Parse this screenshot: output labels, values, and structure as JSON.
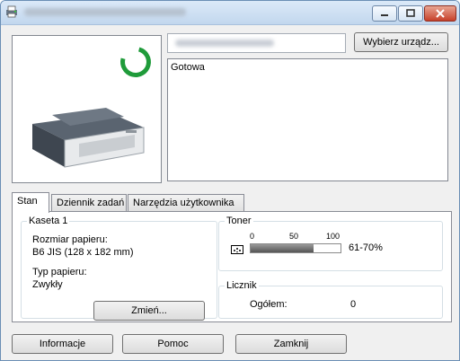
{
  "printer": {
    "status": "Gotowa"
  },
  "buttons": {
    "select_device": "Wybierz urządz...",
    "change": "Zmień...",
    "info": "Informacje",
    "help": "Pomoc",
    "close": "Zamknij"
  },
  "tabs": [
    {
      "label": "Stan",
      "active": true
    },
    {
      "label": "Dziennik zadań",
      "active": false
    },
    {
      "label": "Narzędzia użytkownika",
      "active": false
    }
  ],
  "tray": {
    "title": "Kaseta 1",
    "paper_size_label": "Rozmiar papieru:",
    "paper_size_value": "B6 JIS (128 x 182 mm)",
    "paper_type_label": "Typ papieru:",
    "paper_type_value": "Zwykły"
  },
  "toner": {
    "title": "Toner",
    "scale": [
      "0",
      "50",
      "100"
    ],
    "level_fraction": 0.7,
    "level_text": "61-70%",
    "icon": "toner-icon",
    "fill_color": "#666666"
  },
  "counter": {
    "title": "Licznik",
    "total_label": "Ogółem:",
    "total_value": "0"
  },
  "colors": {
    "ready_spinner": "#1f9b3a",
    "close_button": "#c7412a"
  }
}
